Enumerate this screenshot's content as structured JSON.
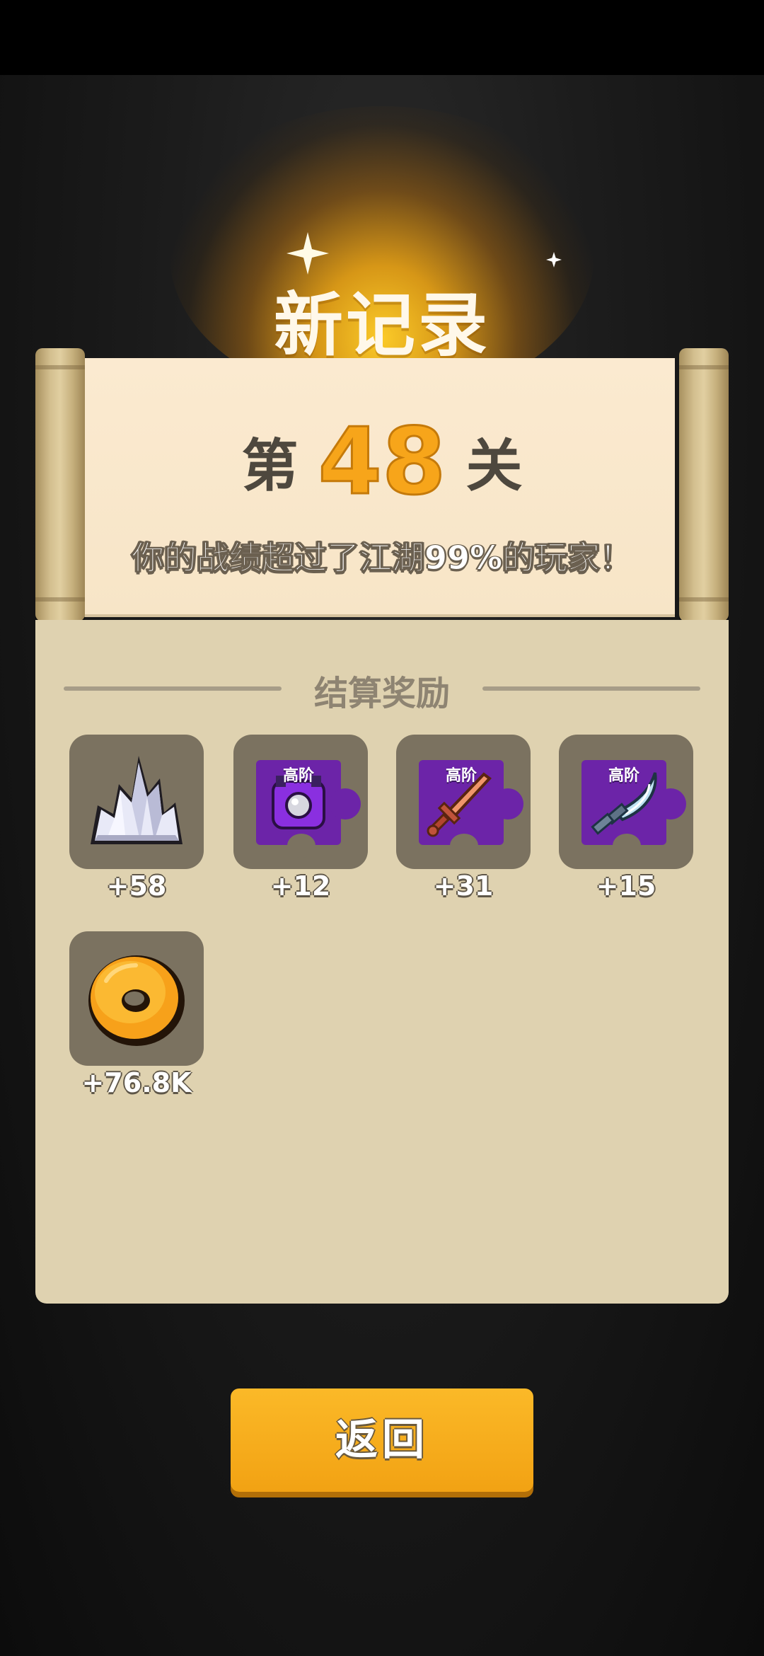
{
  "header": {
    "title": "新记录"
  },
  "level": {
    "prefix": "第",
    "number": "48",
    "suffix": "关"
  },
  "record_text": "你的战绩超过了江湖99%的玩家！",
  "rewards": {
    "title": "结算奖励",
    "items": [
      {
        "icon": "crystal-icon",
        "tier": "",
        "count": "+58"
      },
      {
        "icon": "armor-fragment-icon",
        "tier": "高阶",
        "count": "+12"
      },
      {
        "icon": "sword-fragment-icon",
        "tier": "高阶",
        "count": "+31"
      },
      {
        "icon": "saber-fragment-icon",
        "tier": "高阶",
        "count": "+15"
      },
      {
        "icon": "gold-coin-icon",
        "tier": "",
        "count": "+76.8K"
      }
    ]
  },
  "buttons": {
    "back_label": "返回"
  },
  "colors": {
    "accent": "#f7a51a",
    "button": "#f5aa1b",
    "paper": "#fbead0",
    "panel": "#dfd2b0",
    "tile": "#7b7260",
    "puzzle_purple": "#6c24a8"
  }
}
